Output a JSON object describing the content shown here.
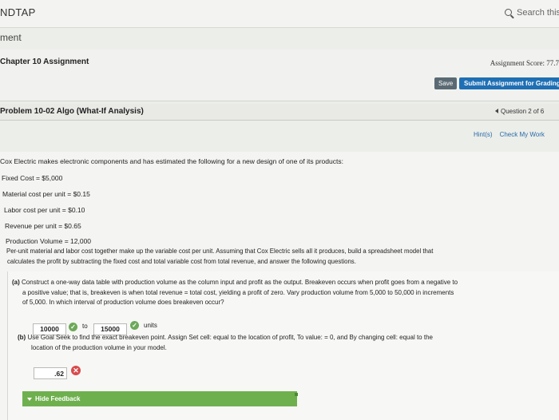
{
  "app": {
    "brand": "NDTAP"
  },
  "search": {
    "placeholder": "Search this"
  },
  "breadcrumb": "ment",
  "assignment": {
    "chapter_title": "Chapter 10 Assignment",
    "score_label": "Assignment Score: 77.7",
    "save_label": "Save",
    "submit_label": "Submit Assignment for Grading"
  },
  "problem": {
    "title": "Problem 10-02 Algo (What-If Analysis)",
    "question_nav": "Question 2 of 6",
    "hints_label": "Hint(s)",
    "check_label": "Check My Work"
  },
  "body": {
    "intro": "Cox Electric makes electronic components and has estimated the following for a new design of one of its products:",
    "vars": [
      "Fixed Cost = $5,000",
      "Material cost per unit = $0.15",
      "Labor cost per unit = $0.10",
      "Revenue per unit = $0.65",
      "Production Volume = 12,000"
    ],
    "para1": "Per-unit material and labor cost together make up the variable cost per unit. Assuming that Cox Electric sells all it produces, build a spreadsheet model that",
    "para2": "calculates the profit by subtracting the fixed cost and total variable cost from total revenue, and answer the following questions."
  },
  "part_a": {
    "label": "(a)",
    "text1": "Construct a one-way data table with production volume as the column input and profit as the output. Breakeven occurs when profit goes from a negative to",
    "text2": "a positive value; that is, breakeven is when total revenue = total cost, yielding a profit of zero. Vary production volume from 5,000 to 50,000 in increments",
    "text3": "of 5,000. In which interval of production volume does breakeven occur?",
    "answer_low": "10000",
    "to_label": "to",
    "answer_high": "15000",
    "units_label": "units"
  },
  "part_b": {
    "label": "(b)",
    "text1": "Use Goal Seek to find the exact breakeven point. Assign Set cell: equal to the location of profit, To value: = 0, and By changing cell: equal to the",
    "text2": "location of the production volume in your model.",
    "answer": ".62"
  },
  "feedback": {
    "label": "Hide Feedback"
  },
  "colors": {
    "correct": "#6da95a",
    "incorrect": "#d84a4a",
    "link": "#2a6aa8",
    "submit": "#1f6fb4",
    "feedback": "#6fb04e"
  }
}
